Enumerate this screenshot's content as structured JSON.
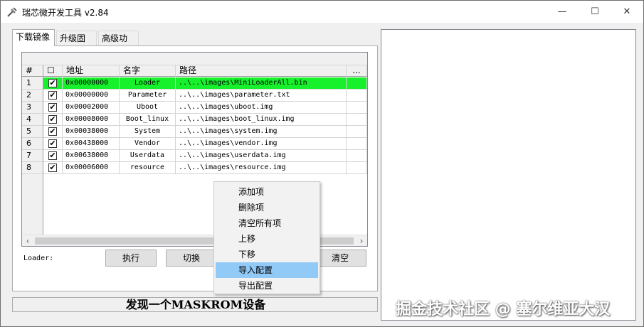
{
  "window": {
    "title": "瑞芯微开发工具 v2.84",
    "minimize_glyph": "—",
    "maximize_glyph": "☐",
    "close_glyph": "✕"
  },
  "tabs": [
    {
      "label": "下载镜像",
      "active": true
    },
    {
      "label": "升级固件",
      "active": false
    },
    {
      "label": "高级功能",
      "active": false
    }
  ],
  "table": {
    "columns": [
      "#",
      "☐",
      "地址",
      "名字",
      "路径",
      "..."
    ],
    "rows": [
      {
        "num": "1",
        "checked": "✔",
        "address": "0x00000000",
        "name": "Loader",
        "path": "..\\..\\images\\MiniLoaderAll.bin",
        "highlight": true
      },
      {
        "num": "2",
        "checked": "✔",
        "address": "0x00000000",
        "name": "Parameter",
        "path": "..\\..\\images\\parameter.txt",
        "highlight": false
      },
      {
        "num": "3",
        "checked": "✔",
        "address": "0x00002000",
        "name": "Uboot",
        "path": "..\\..\\images\\uboot.img",
        "highlight": false
      },
      {
        "num": "4",
        "checked": "✔",
        "address": "0x00008000",
        "name": "Boot_linux",
        "path": "..\\..\\images\\boot_linux.img",
        "highlight": false
      },
      {
        "num": "5",
        "checked": "✔",
        "address": "0x00038000",
        "name": "System",
        "path": "..\\..\\images\\system.img",
        "highlight": false
      },
      {
        "num": "6",
        "checked": "✔",
        "address": "0x00438000",
        "name": "Vendor",
        "path": "..\\..\\images\\vendor.img",
        "highlight": false
      },
      {
        "num": "7",
        "checked": "✔",
        "address": "0x00638000",
        "name": "Userdata",
        "path": "..\\..\\images\\userdata.img",
        "highlight": false
      },
      {
        "num": "8",
        "checked": "✔",
        "address": "0x00006000",
        "name": "resource",
        "path": "..\\..\\images\\resource.img",
        "highlight": false
      }
    ],
    "highlight_color": "#16f12c",
    "scroll_left": "‹",
    "scroll_right": "›"
  },
  "loader_label": "Loader:",
  "buttons": {
    "execute": "执行",
    "switch": "切换",
    "clear": "清空"
  },
  "context_menu": {
    "items": [
      "添加项",
      "删除项",
      "清空所有项",
      "上移",
      "下移",
      "导入配置",
      "导出配置"
    ],
    "hovered_index": 5,
    "hover_color": "#91c9f7"
  },
  "status": {
    "text": "发现一个MASKROM设备"
  },
  "watermark": "掘金技术社区 @ 塞尔维亚大汉"
}
